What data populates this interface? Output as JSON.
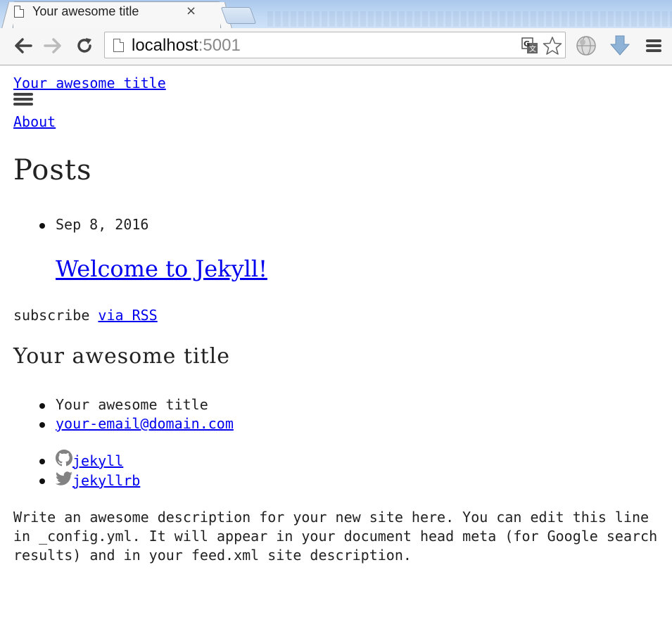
{
  "browser": {
    "tab_title": "Your awesome title",
    "tab_close": "×",
    "url_host": "localhost",
    "url_port": ":5001"
  },
  "site": {
    "title": "Your awesome title",
    "nav": {
      "about": "About"
    }
  },
  "main": {
    "heading": "Posts",
    "posts": [
      {
        "date": "Sep 8, 2016",
        "title": "Welcome to Jekyll!"
      }
    ],
    "subscribe_text": "subscribe",
    "subscribe_link": "via RSS"
  },
  "footer": {
    "heading": "Your awesome title",
    "contact_name": "Your awesome title",
    "email": "your-email@domain.com",
    "social": [
      {
        "icon": "github-icon",
        "label": " jekyll"
      },
      {
        "icon": "twitter-icon",
        "label": " jekyllrb"
      }
    ],
    "description": "Write an awesome description for your new site here. You can edit this line in _config.yml. It will appear in your document head meta (for Google search results) and in your feed.xml site description."
  },
  "colors": {
    "link": "#0000ee",
    "text": "#222222",
    "social_icon": "#828282"
  }
}
